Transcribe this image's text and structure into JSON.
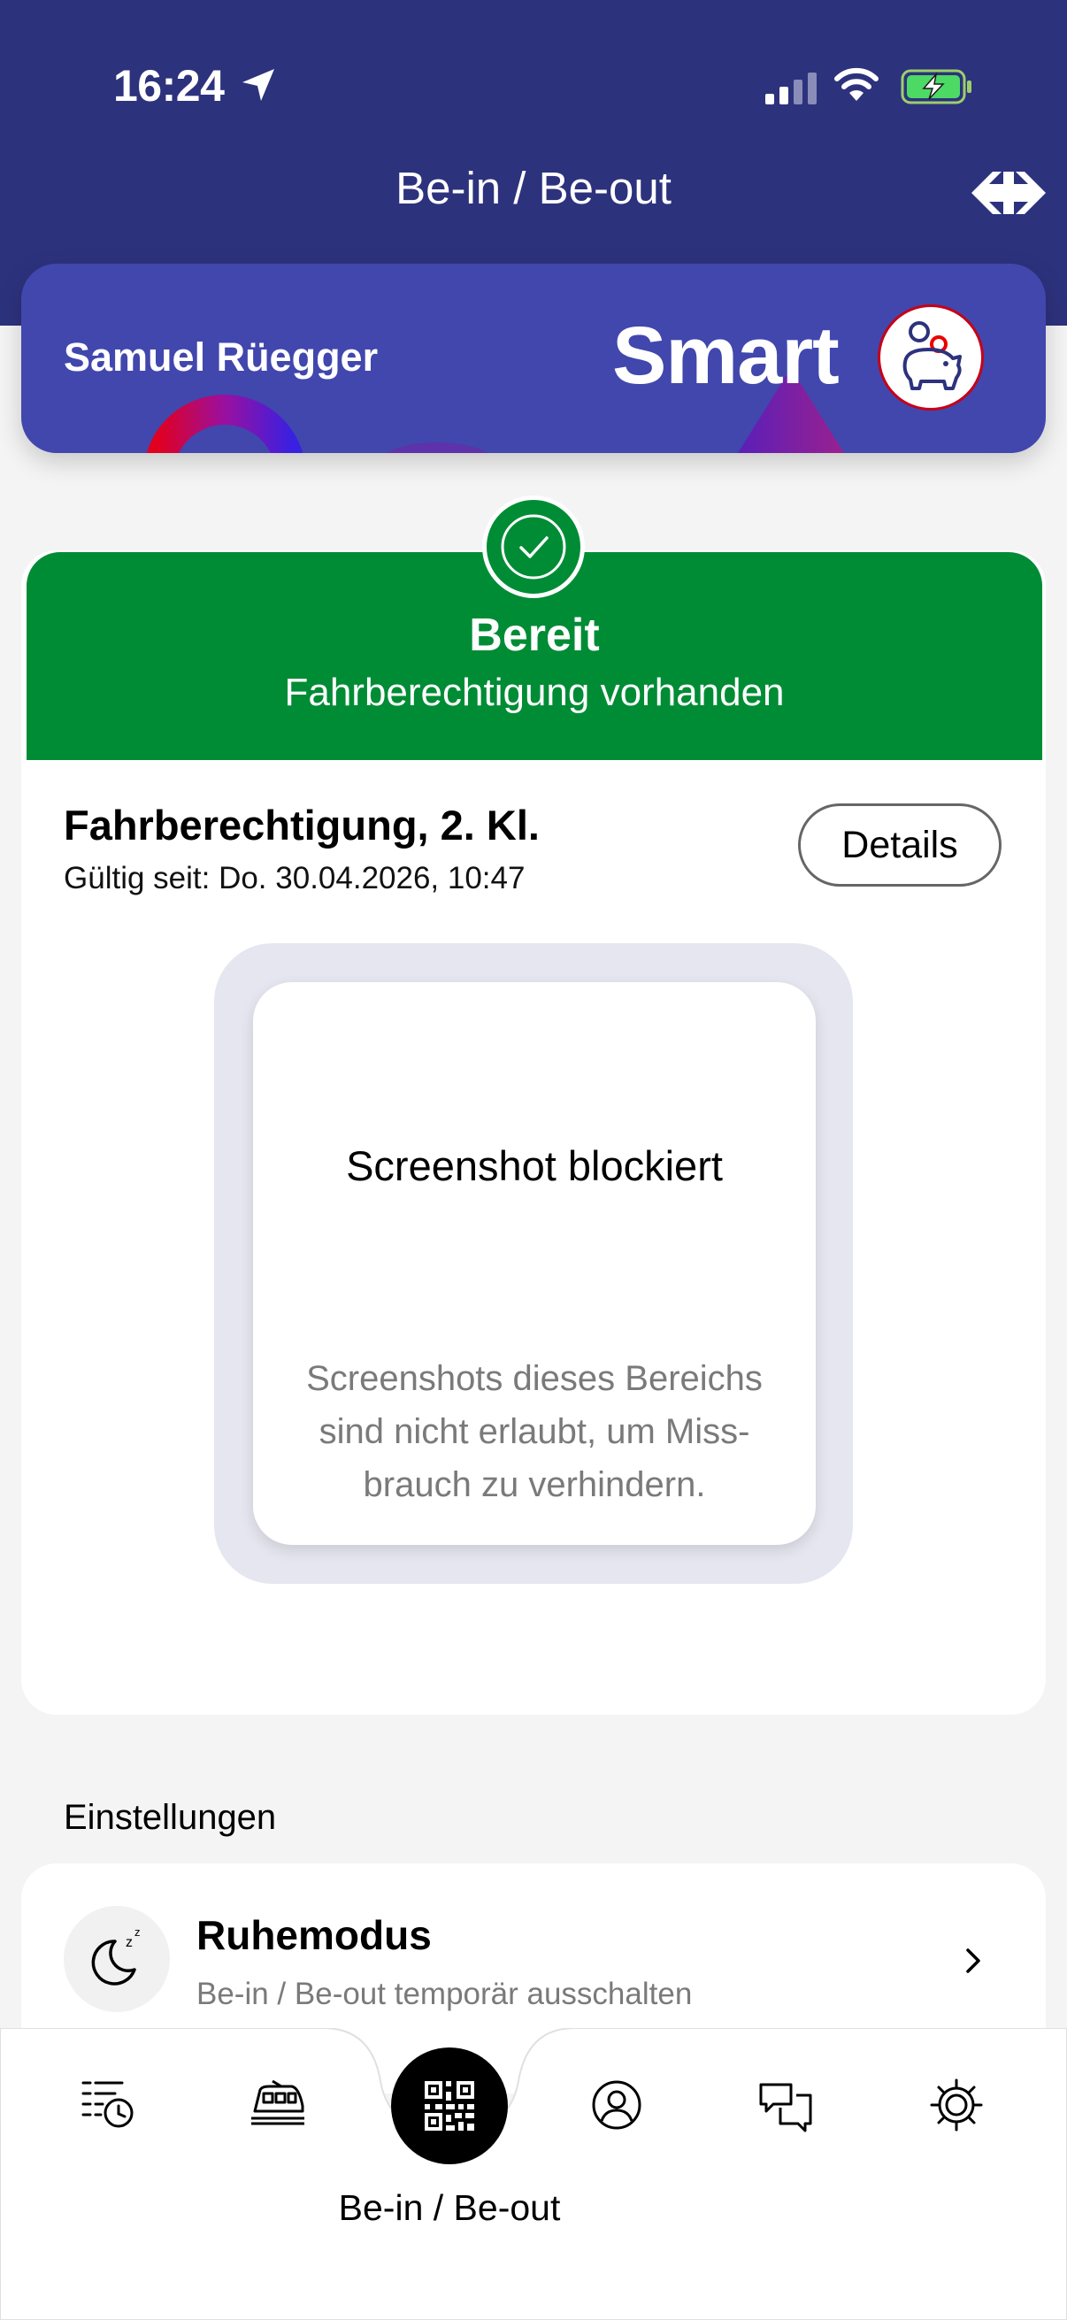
{
  "status_bar": {
    "time": "16:24"
  },
  "nav": {
    "title": "Be-in / Be-out"
  },
  "profile": {
    "name": "Samuel Rüegger",
    "plan": "Smart"
  },
  "status": {
    "title": "Bereit",
    "subtitle": "Fahrberechtigung vorhanden"
  },
  "ticket": {
    "title": "Fahrberechtigung, 2. Kl.",
    "valid_since": "Gültig seit: Do. 30.04.2026, 10:47",
    "details_label": "Details"
  },
  "blocked": {
    "title": "Screenshot blockiert",
    "line1": "Screenshots dieses Bereichs",
    "line2": "sind nicht erlaubt, um Miss-",
    "line3": "brauch zu verhindern."
  },
  "settings": {
    "section_label": "Einstellungen",
    "quiet_mode": {
      "title": "Ruhemodus",
      "subtitle": "Be-in / Be-out temporär ausschalten"
    }
  },
  "tabbar": {
    "center_label": "Be-in / Be-out"
  },
  "colors": {
    "header": "#2d327d",
    "card": "#4147ad",
    "ready_green": "#008c35",
    "sbb_red": "#eb0000"
  }
}
